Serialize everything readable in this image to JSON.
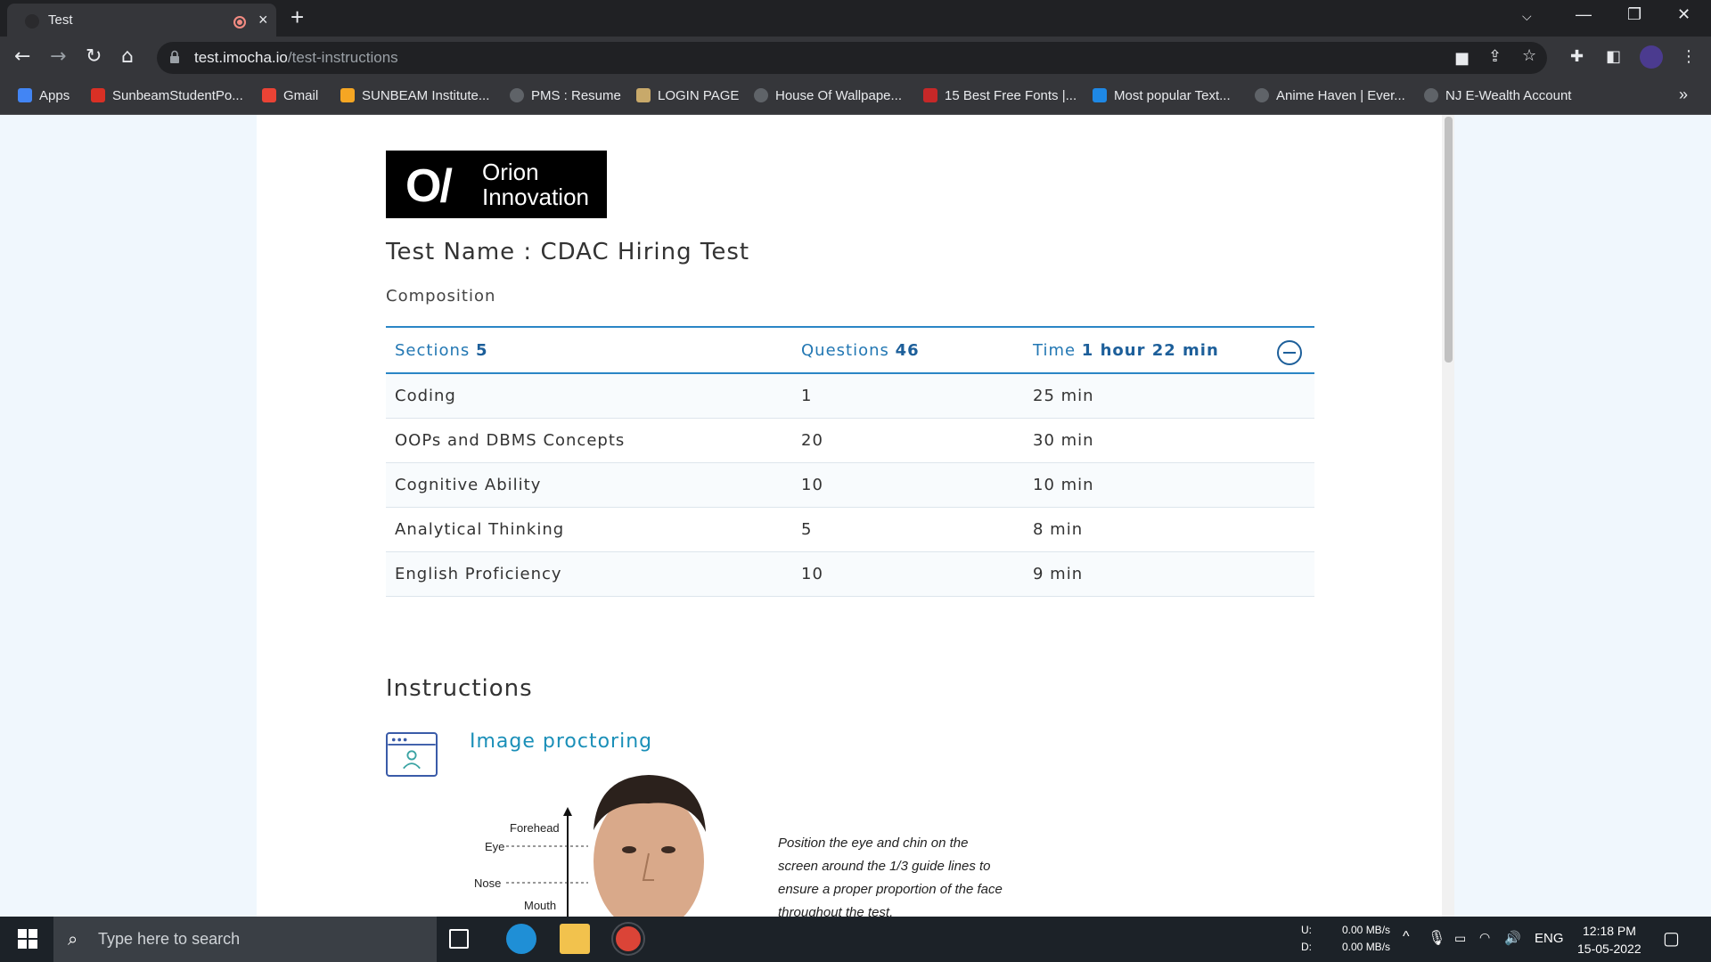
{
  "browser": {
    "tab_title": "Test",
    "new_tab": "+",
    "close_tab": "×",
    "url_domain": "test.imocha.io",
    "url_path": "/test-instructions",
    "window_controls": [
      "⌵",
      "—",
      "❐",
      "✕"
    ]
  },
  "bookmarks": [
    {
      "label": "Apps",
      "icon": "apps-grid-icon",
      "color": "#e8453c"
    },
    {
      "label": "SunbeamStudentPo...",
      "icon": "sunbeam-icon",
      "color": "#d93025"
    },
    {
      "label": "Gmail",
      "icon": "gmail-icon",
      "color": "#ea4335"
    },
    {
      "label": "SUNBEAM Institute...",
      "icon": "sunbeam-in-icon",
      "color": "#f5a623"
    },
    {
      "label": "PMS : Resume",
      "icon": "globe-icon",
      "color": "#9aa0a6"
    },
    {
      "label": "LOGIN PAGE",
      "icon": "login-icon",
      "color": "#c8a96a"
    },
    {
      "label": "House Of Wallpape...",
      "icon": "globe-icon",
      "color": "#9aa0a6"
    },
    {
      "label": "15 Best Free Fonts |...",
      "icon": "gdi-icon",
      "color": "#c62828"
    },
    {
      "label": "Most popular Text...",
      "icon": "heart-icon",
      "color": "#1e88e5"
    },
    {
      "label": "Anime Haven | Ever...",
      "icon": "globe-icon",
      "color": "#9aa0a6"
    },
    {
      "label": "NJ E-Wealth Account",
      "icon": "globe-icon",
      "color": "#9aa0a6"
    }
  ],
  "bookmarks_more": "»",
  "logo": {
    "mark": "O/",
    "line1": "Orion",
    "line2": "Innovation"
  },
  "test_name": "Test Name : CDAC Hiring Test",
  "composition_label": "Composition",
  "summary": {
    "sections_label": "Sections",
    "sections_value": "5",
    "questions_label": "Questions",
    "questions_value": "46",
    "time_label": "Time",
    "time_value": "1 hour 22 min"
  },
  "sections": [
    {
      "name": "Coding",
      "questions": "1",
      "time": "25 min"
    },
    {
      "name": "OOPs and DBMS Concepts",
      "questions": "20",
      "time": "30 min"
    },
    {
      "name": "Cognitive Ability",
      "questions": "10",
      "time": "10 min"
    },
    {
      "name": "Analytical Thinking",
      "questions": "5",
      "time": "8 min"
    },
    {
      "name": "English Proficiency",
      "questions": "10",
      "time": "9 min"
    }
  ],
  "instructions_heading": "Instructions",
  "proctoring_title": "Image proctoring",
  "diagram": {
    "forehead": "Forehead",
    "eye": "Eye",
    "nose": "Nose",
    "mouth": "Mouth",
    "note": "Position the eye and chin on the screen around the 1/3 guide lines to ensure a proper proportion of the face throughout the test."
  },
  "taskbar": {
    "search_placeholder": "Type here to search",
    "net_up_label": "U:",
    "net_down_label": "D:",
    "net_up": "0.00 MB/s",
    "net_down": "0.00 MB/s",
    "language": "ENG",
    "time": "12:18 PM",
    "date": "15-05-2022"
  },
  "colors": {
    "accent": "#2277b3",
    "link": "#1a8fb8",
    "chrome_dark": "#202124"
  }
}
